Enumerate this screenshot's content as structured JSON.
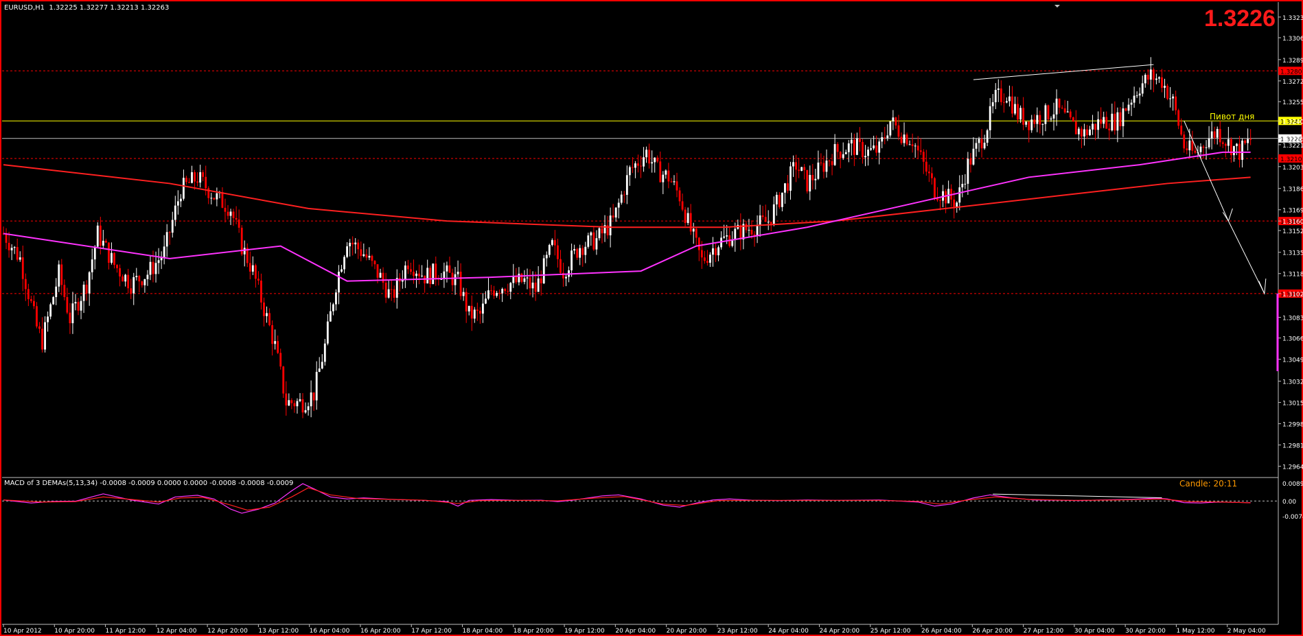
{
  "header": {
    "symbol_info": "EURUSD,H1  1.32225 1.32277 1.32213 1.32263",
    "big_price": "1.3226",
    "pivot_label": "Пивот дня"
  },
  "macd_panel": {
    "title": "MACD of 3 DEMAs(5,13,34) -0.0008 -0.0009 0.0000 0.0000 -0.0008 -0.0008 -0.0009",
    "candle_timer": "Candle:  20:11",
    "ticks": [
      "0.0089",
      "0.00",
      "-0.0074"
    ]
  },
  "colors": {
    "background": "#000000",
    "bull_candle": "#ffffff",
    "bear_candle": "#ff0000",
    "ma_magenta": "#ff33ff",
    "ma_red": "#ff2020",
    "pivot_line": "#ffff00",
    "level_line": "#ff0000",
    "trend_line": "#ffffff",
    "frame": "#ff0000"
  },
  "chart_data": {
    "type": "candlestick",
    "symbol": "EURUSD",
    "timeframe": "H1",
    "ylim": [
      1.2955,
      1.3335
    ],
    "y_ticks": [
      "1.3323",
      "1.33065",
      "1.3289",
      "1.3272",
      "1.32554",
      "1.3240",
      "1.3226",
      "1.32210",
      "1.32035",
      "1.3186",
      "1.3169",
      "1.3160",
      "1.31524",
      "1.3135",
      "1.3118",
      "1.3102",
      "1.30830",
      "1.30665",
      "1.30495",
      "1.3032",
      "1.3015",
      "1.2998",
      "1.2981",
      "1.2964"
    ],
    "x_labels": [
      "10 Apr 2012",
      "10 Apr 20:00",
      "11 Apr 12:00",
      "12 Apr 04:00",
      "12 Apr 20:00",
      "13 Apr 12:00",
      "16 Apr 04:00",
      "16 Apr 20:00",
      "17 Apr 12:00",
      "18 Apr 04:00",
      "18 Apr 20:00",
      "19 Apr 12:00",
      "20 Apr 04:00",
      "20 Apr 20:00",
      "23 Apr 12:00",
      "24 Apr 04:00",
      "24 Apr 20:00",
      "25 Apr 12:00",
      "26 Apr 04:00",
      "26 Apr 20:00",
      "27 Apr 12:00",
      "30 Apr 04:00",
      "30 Apr 20:00",
      "1 May 12:00",
      "2 May 04:00"
    ],
    "last_price": 1.3226,
    "levels": [
      {
        "price": 1.328,
        "label": "1.3280",
        "color": "#ff0000"
      },
      {
        "price": 1.324,
        "label": "1.3240",
        "color": "#ffff00"
      },
      {
        "price": 1.3226,
        "label": "1.3226",
        "color": "#c0c0c0"
      },
      {
        "price": 1.321,
        "label": "1.3210",
        "color": "#ff0000"
      },
      {
        "price": 1.316,
        "label": "1.3160",
        "color": "#ff0000"
      },
      {
        "price": 1.3102,
        "label": "1.3102",
        "color": "#ff0000"
      }
    ],
    "path": [
      [
        0,
        1.315
      ],
      [
        6,
        1.313
      ],
      [
        12,
        1.3075
      ],
      [
        14,
        1.3064
      ],
      [
        20,
        1.3118
      ],
      [
        24,
        1.3082
      ],
      [
        30,
        1.311
      ],
      [
        34,
        1.315
      ],
      [
        40,
        1.3125
      ],
      [
        46,
        1.311
      ],
      [
        52,
        1.3118
      ],
      [
        58,
        1.3135
      ],
      [
        64,
        1.3185
      ],
      [
        70,
        1.3195
      ],
      [
        76,
        1.318
      ],
      [
        82,
        1.317
      ],
      [
        86,
        1.314
      ],
      [
        90,
        1.312
      ],
      [
        94,
        1.309
      ],
      [
        98,
        1.306
      ],
      [
        102,
        1.3015
      ],
      [
        108,
        1.3015
      ],
      [
        112,
        1.3022
      ],
      [
        116,
        1.306
      ],
      [
        120,
        1.311
      ],
      [
        124,
        1.3146
      ],
      [
        130,
        1.3134
      ],
      [
        136,
        1.3115
      ],
      [
        140,
        1.3098
      ],
      [
        146,
        1.3128
      ],
      [
        152,
        1.3116
      ],
      [
        158,
        1.312
      ],
      [
        164,
        1.3112
      ],
      [
        168,
        1.3085
      ],
      [
        172,
        1.3085
      ],
      [
        176,
        1.3105
      ],
      [
        182,
        1.311
      ],
      [
        188,
        1.3112
      ],
      [
        192,
        1.3105
      ],
      [
        198,
        1.314
      ],
      [
        202,
        1.312
      ],
      [
        208,
        1.314
      ],
      [
        214,
        1.3145
      ],
      [
        220,
        1.316
      ],
      [
        226,
        1.32
      ],
      [
        232,
        1.3215
      ],
      [
        236,
        1.32
      ],
      [
        240,
        1.3195
      ],
      [
        244,
        1.318
      ],
      [
        248,
        1.3152
      ],
      [
        252,
        1.3128
      ],
      [
        258,
        1.3143
      ],
      [
        264,
        1.315
      ],
      [
        270,
        1.3155
      ],
      [
        276,
        1.316
      ],
      [
        280,
        1.3178
      ],
      [
        286,
        1.3205
      ],
      [
        290,
        1.319
      ],
      [
        294,
        1.32
      ],
      [
        300,
        1.3215
      ],
      [
        306,
        1.322
      ],
      [
        312,
        1.3215
      ],
      [
        316,
        1.3217
      ],
      [
        320,
        1.324
      ],
      [
        324,
        1.323
      ],
      [
        328,
        1.3225
      ],
      [
        332,
        1.3205
      ],
      [
        336,
        1.3185
      ],
      [
        340,
        1.318
      ],
      [
        344,
        1.3175
      ],
      [
        348,
        1.3205
      ],
      [
        354,
        1.323
      ],
      [
        358,
        1.3258
      ],
      [
        362,
        1.3262
      ],
      [
        366,
        1.3245
      ],
      [
        370,
        1.324
      ],
      [
        376,
        1.3245
      ],
      [
        380,
        1.325
      ],
      [
        386,
        1.3235
      ],
      [
        390,
        1.323
      ],
      [
        396,
        1.324
      ],
      [
        402,
        1.324
      ],
      [
        406,
        1.3255
      ],
      [
        410,
        1.3268
      ],
      [
        414,
        1.3276
      ],
      [
        418,
        1.3272
      ],
      [
        422,
        1.3255
      ],
      [
        426,
        1.322
      ],
      [
        430,
        1.3213
      ],
      [
        434,
        1.3225
      ],
      [
        438,
        1.3232
      ],
      [
        442,
        1.3222
      ],
      [
        446,
        1.3215
      ],
      [
        450,
        1.3225
      ]
    ],
    "ma_magenta": [
      [
        0,
        1.315
      ],
      [
        60,
        1.313
      ],
      [
        100,
        1.314
      ],
      [
        124,
        1.3112
      ],
      [
        175,
        1.3115
      ],
      [
        230,
        1.312
      ],
      [
        250,
        1.314
      ],
      [
        290,
        1.3155
      ],
      [
        330,
        1.3175
      ],
      [
        370,
        1.3195
      ],
      [
        410,
        1.3205
      ],
      [
        440,
        1.3215
      ],
      [
        450,
        1.3215
      ]
    ],
    "ma_red": [
      [
        0,
        1.3205
      ],
      [
        60,
        1.319
      ],
      [
        110,
        1.317
      ],
      [
        160,
        1.316
      ],
      [
        220,
        1.3155
      ],
      [
        260,
        1.3155
      ],
      [
        300,
        1.316
      ],
      [
        340,
        1.317
      ],
      [
        380,
        1.318
      ],
      [
        420,
        1.319
      ],
      [
        450,
        1.3195
      ]
    ],
    "macd_ylim": [
      -0.008,
      0.0095
    ],
    "macd_main": [
      [
        0,
        0.0005
      ],
      [
        10,
        -0.001
      ],
      [
        18,
        -0.0002
      ],
      [
        26,
        -0.0001
      ],
      [
        36,
        0.0035
      ],
      [
        46,
        0.0005
      ],
      [
        56,
        -0.0015
      ],
      [
        62,
        0.002
      ],
      [
        70,
        0.0028
      ],
      [
        76,
        0.001
      ],
      [
        82,
        -0.004
      ],
      [
        86,
        -0.006
      ],
      [
        92,
        -0.004
      ],
      [
        98,
        -0.001
      ],
      [
        104,
        0.005
      ],
      [
        108,
        0.0085
      ],
      [
        112,
        0.006
      ],
      [
        118,
        0.002
      ],
      [
        124,
        0.001
      ],
      [
        130,
        0.0015
      ],
      [
        140,
        0.0008
      ],
      [
        152,
        0.0003
      ],
      [
        160,
        -0.0003
      ],
      [
        164,
        -0.0025
      ],
      [
        168,
        0.0003
      ],
      [
        176,
        0.0007
      ],
      [
        186,
        0.0003
      ],
      [
        194,
        0.0004
      ],
      [
        200,
        -0.0003
      ],
      [
        206,
        0.0005
      ],
      [
        216,
        0.0025
      ],
      [
        222,
        0.003
      ],
      [
        230,
        0.001
      ],
      [
        238,
        -0.002
      ],
      [
        244,
        -0.003
      ],
      [
        250,
        -0.001
      ],
      [
        256,
        0.0005
      ],
      [
        262,
        0.001
      ],
      [
        270,
        0.0004
      ],
      [
        280,
        0.0002
      ],
      [
        290,
        0.0005
      ],
      [
        300,
        0.0003
      ],
      [
        316,
        0.0005
      ],
      [
        330,
        -0.0005
      ],
      [
        336,
        -0.0025
      ],
      [
        342,
        -0.0015
      ],
      [
        350,
        0.0015
      ],
      [
        356,
        0.003
      ],
      [
        364,
        0.0015
      ],
      [
        372,
        0.0005
      ],
      [
        380,
        0.0004
      ],
      [
        388,
        0.0002
      ],
      [
        396,
        0.0005
      ],
      [
        406,
        0.0008
      ],
      [
        416,
        0.0014
      ],
      [
        420,
        0.001
      ],
      [
        426,
        -0.0008
      ],
      [
        432,
        -0.001
      ],
      [
        438,
        -0.0005
      ],
      [
        444,
        -0.0007
      ],
      [
        450,
        -0.0008
      ]
    ],
    "macd_signal": [
      [
        0,
        0.0005
      ],
      [
        14,
        -0.0005
      ],
      [
        26,
        -0.0003
      ],
      [
        36,
        0.002
      ],
      [
        46,
        0.0008
      ],
      [
        56,
        -0.0005
      ],
      [
        64,
        0.0015
      ],
      [
        72,
        0.0018
      ],
      [
        82,
        -0.002
      ],
      [
        88,
        -0.0045
      ],
      [
        96,
        -0.003
      ],
      [
        104,
        0.002
      ],
      [
        110,
        0.0065
      ],
      [
        118,
        0.003
      ],
      [
        128,
        0.0012
      ],
      [
        140,
        0.0008
      ],
      [
        152,
        0.0004
      ],
      [
        164,
        -0.0012
      ],
      [
        172,
        0.0002
      ],
      [
        186,
        0.0003
      ],
      [
        200,
        0.0001
      ],
      [
        214,
        0.0015
      ],
      [
        224,
        0.0022
      ],
      [
        238,
        -0.0015
      ],
      [
        246,
        -0.0022
      ],
      [
        258,
        0.0002
      ],
      [
        270,
        0.0003
      ],
      [
        290,
        0.0003
      ],
      [
        316,
        0.0003
      ],
      [
        330,
        -0.0002
      ],
      [
        338,
        -0.0015
      ],
      [
        348,
        0.0005
      ],
      [
        358,
        0.002
      ],
      [
        370,
        0.0008
      ],
      [
        386,
        0.0003
      ],
      [
        402,
        0.0005
      ],
      [
        418,
        0.001
      ],
      [
        428,
        -0.0003
      ],
      [
        440,
        -0.0005
      ],
      [
        450,
        -0.0009
      ]
    ]
  }
}
